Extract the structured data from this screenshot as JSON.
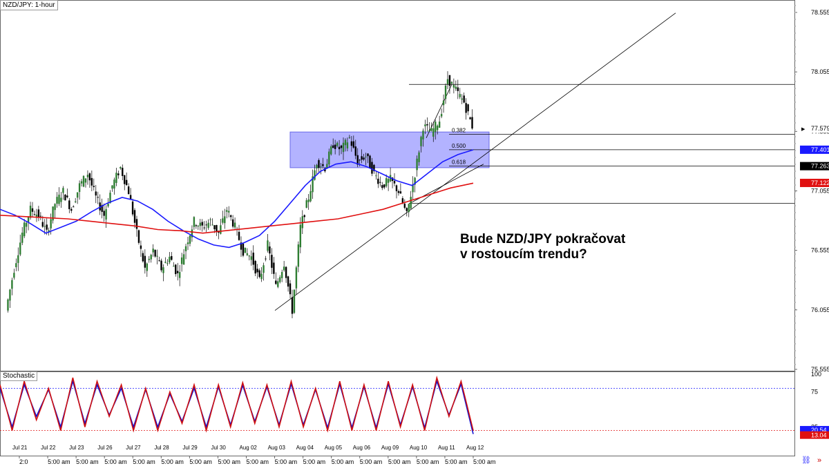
{
  "window_title": "NZD/JPY: 1-hour",
  "annotation": {
    "line1": "Bude NZD/JPY pokračovat",
    "line2": "v rostoucím trendu?"
  },
  "indicator_label": "Stochastic",
  "colors": {
    "candle_up": "#2e7d32",
    "candle_down": "#000000",
    "ma_blue": "#1a1aff",
    "ma_red": "#e01010",
    "zone": "#8080ff",
    "stoch_k": "#d01010",
    "stoch_d": "#1010d0"
  },
  "icons": {
    "left": "chain-link-icon",
    "right": "double-chevron-right-icon"
  },
  "chart_data": [
    {
      "type": "line",
      "title": "NZD/JPY: 1-hour",
      "ylim": [
        75.555,
        78.555
      ],
      "y_ticks": [
        78.555,
        78.055,
        77.555,
        77.055,
        76.555,
        76.055,
        75.555
      ],
      "x_labels": [
        "Jul 21",
        "Jul 22",
        "Jul 23",
        "Jul 26",
        "Jul 27",
        "Jul 28",
        "Jul 29",
        "Jul 30",
        "Aug 02",
        "Aug 03",
        "Aug 04",
        "Aug 05",
        "Aug 06",
        "Aug 09",
        "Aug 10",
        "Aug 11",
        "Aug 12"
      ],
      "x_sub_labels": [
        "2:0",
        "5:00 am",
        "5:00 am",
        "5:00 am",
        "5:00 am",
        "5:00 am",
        "5:00 am",
        "5:00 am",
        "5:00 am",
        "5:00 am",
        "5:00 am",
        "5:00 am",
        "5:00 am",
        "5:00 am",
        "5:00 am",
        "5:00 am",
        "5:00 am"
      ],
      "price_series": [
        76.05,
        76.4,
        76.7,
        76.9,
        76.85,
        76.7,
        76.95,
        77.05,
        76.9,
        77.1,
        77.2,
        77.0,
        76.85,
        77.1,
        77.25,
        77.05,
        76.7,
        76.4,
        76.55,
        76.4,
        76.5,
        76.35,
        76.6,
        76.8,
        76.75,
        76.8,
        76.7,
        76.9,
        76.75,
        76.55,
        76.5,
        76.3,
        76.6,
        76.25,
        76.45,
        76.05,
        76.75,
        77.0,
        77.3,
        77.25,
        77.45,
        77.4,
        77.5,
        77.3,
        77.35,
        77.2,
        77.1,
        77.15,
        77.05,
        76.85,
        77.2,
        77.6,
        77.55,
        77.65,
        78.0,
        77.9,
        77.8,
        77.6
      ],
      "series": [
        {
          "name": "",
          "values": [
            76.9,
            76.85,
            76.78,
            76.7,
            76.75,
            76.8,
            76.88,
            76.95,
            77.0,
            76.97,
            76.9,
            76.8,
            76.72,
            76.65,
            76.6,
            76.58,
            76.62,
            76.68,
            76.8,
            76.95,
            77.1,
            77.22,
            77.28,
            77.3,
            77.26,
            77.2,
            77.14,
            77.1,
            77.2,
            77.3,
            77.36,
            77.4
          ]
        },
        {
          "name": "",
          "values": [
            76.85,
            76.84,
            76.83,
            76.82,
            76.8,
            76.78,
            76.76,
            76.73,
            76.72,
            76.7,
            76.72,
            76.74,
            76.76,
            76.78,
            76.8,
            76.82,
            76.86,
            76.9,
            76.96,
            77.02,
            77.08,
            77.12
          ]
        }
      ],
      "horizontal_levels": [
        77.95,
        77.53,
        77.401,
        77.263,
        76.95
      ],
      "fib_labels": [
        "0.382",
        "0.500",
        "0.618"
      ],
      "price_tags": [
        {
          "label": "77.579",
          "value": 77.579,
          "color": "#000000"
        },
        {
          "label": "77.401",
          "value": 77.401,
          "color": "#1a1aff"
        },
        {
          "label": "77.263",
          "value": 77.263,
          "color": "#000000"
        },
        {
          "label": "77.122",
          "value": 77.122,
          "color": "#e01010"
        }
      ],
      "zone": {
        "x_from_label": "Aug 04",
        "x_to_label": "Aug 12",
        "y_low": 77.25,
        "y_high": 77.55
      }
    },
    {
      "type": "line",
      "title": "Stochastic",
      "ylim": [
        0,
        100
      ],
      "y_ticks": [
        100,
        75,
        25
      ],
      "levels": [
        80,
        20
      ],
      "series": [
        {
          "name": "%K",
          "values": [
            85,
            20,
            90,
            35,
            80,
            20,
            95,
            25,
            90,
            40,
            85,
            20,
            80,
            20,
            75,
            30,
            85,
            20,
            85,
            25,
            88,
            30,
            85,
            25,
            90,
            25,
            80,
            20,
            90,
            20,
            85,
            20,
            90,
            25,
            85,
            20,
            95,
            40,
            90,
            20
          ]
        },
        {
          "name": "%D",
          "values": [
            80,
            25,
            85,
            40,
            78,
            25,
            90,
            30,
            85,
            42,
            80,
            25,
            78,
            25,
            72,
            33,
            80,
            25,
            82,
            28,
            84,
            33,
            82,
            28,
            86,
            28,
            78,
            24,
            86,
            24,
            82,
            24,
            86,
            28,
            82,
            24,
            90,
            42,
            86,
            15
          ]
        }
      ],
      "value_tags": [
        {
          "label": "20.54",
          "value": 20.54,
          "color": "#1a1aff"
        },
        {
          "label": "13.04",
          "value": 13.04,
          "color": "#e01010"
        }
      ]
    }
  ]
}
